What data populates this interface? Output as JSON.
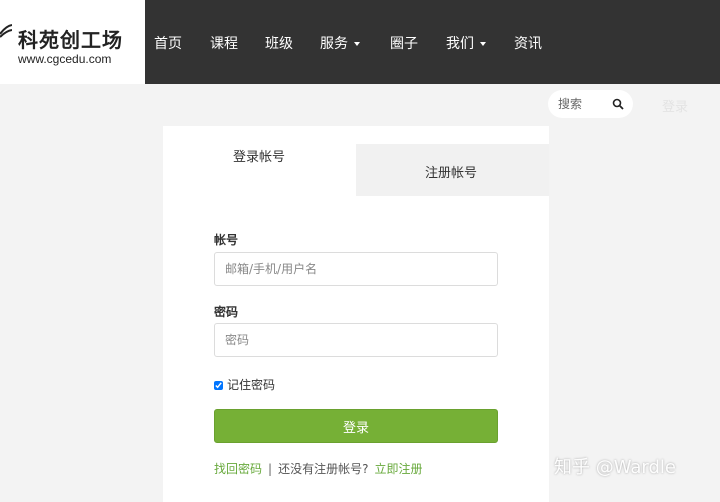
{
  "logo": {
    "title": "科苑创工场",
    "url": "www.cgcedu.com"
  },
  "nav": [
    {
      "label": "首页",
      "dropdown": false
    },
    {
      "label": "课程",
      "dropdown": false
    },
    {
      "label": "班级",
      "dropdown": false
    },
    {
      "label": "服务",
      "dropdown": true
    },
    {
      "label": "圈子",
      "dropdown": false
    },
    {
      "label": "我们",
      "dropdown": true
    },
    {
      "label": "资讯",
      "dropdown": false
    }
  ],
  "search": {
    "placeholder": "搜索"
  },
  "top_login": "登录",
  "tabs": {
    "login": "登录帐号",
    "register": "注册帐号"
  },
  "form": {
    "account_label": "帐号",
    "account_placeholder": "邮箱/手机/用户名",
    "password_label": "密码",
    "password_placeholder": "密码",
    "remember_label": "记住密码",
    "remember_checked": true,
    "submit_label": "登录"
  },
  "links": {
    "forgot": "找回密码",
    "separator": "|",
    "no_account": "还没有注册帐号?",
    "register_now": "立即注册"
  },
  "watermark": "知乎 @Wardle",
  "colors": {
    "header_bg": "#333333",
    "accent_green": "#76b036",
    "link_green": "#67a93b"
  }
}
